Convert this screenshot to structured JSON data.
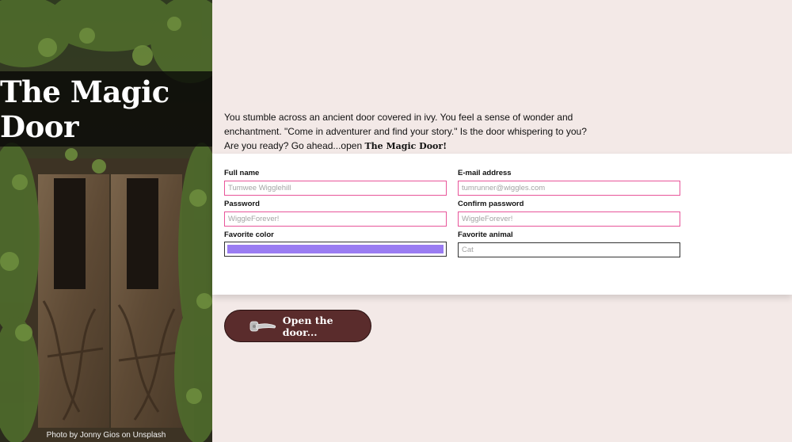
{
  "hero": {
    "title": "The Magic Door",
    "credit": "Photo by Jonny Gios on Unsplash"
  },
  "intro": {
    "text": "You stumble across an ancient door covered in ivy. You feel a sense of wonder and enchantment. \"Come in adventurer and find your story.\" Is the door whispering to you? Are you ready? Go ahead...open ",
    "brand": "The Magic Door!"
  },
  "form": {
    "full_name": {
      "label": "Full name",
      "placeholder": "Tumwee Wigglehill"
    },
    "email": {
      "label": "E-mail address",
      "placeholder": "tumrunner@wiggles.com"
    },
    "password": {
      "label": "Password",
      "placeholder": "WiggleForever!"
    },
    "confirm_password": {
      "label": "Confirm password",
      "placeholder": "WiggleForever!"
    },
    "favorite_color": {
      "label": "Favorite color",
      "value": "#9a7cf2"
    },
    "favorite_animal": {
      "label": "Favorite animal",
      "placeholder": "Cat"
    }
  },
  "submit": {
    "label": "Open the door...",
    "icon": "door-handle-icon"
  },
  "colors": {
    "page_bg": "#f3e9e7",
    "button_bg": "#5a2c2c",
    "input_border": "#e8559a"
  }
}
